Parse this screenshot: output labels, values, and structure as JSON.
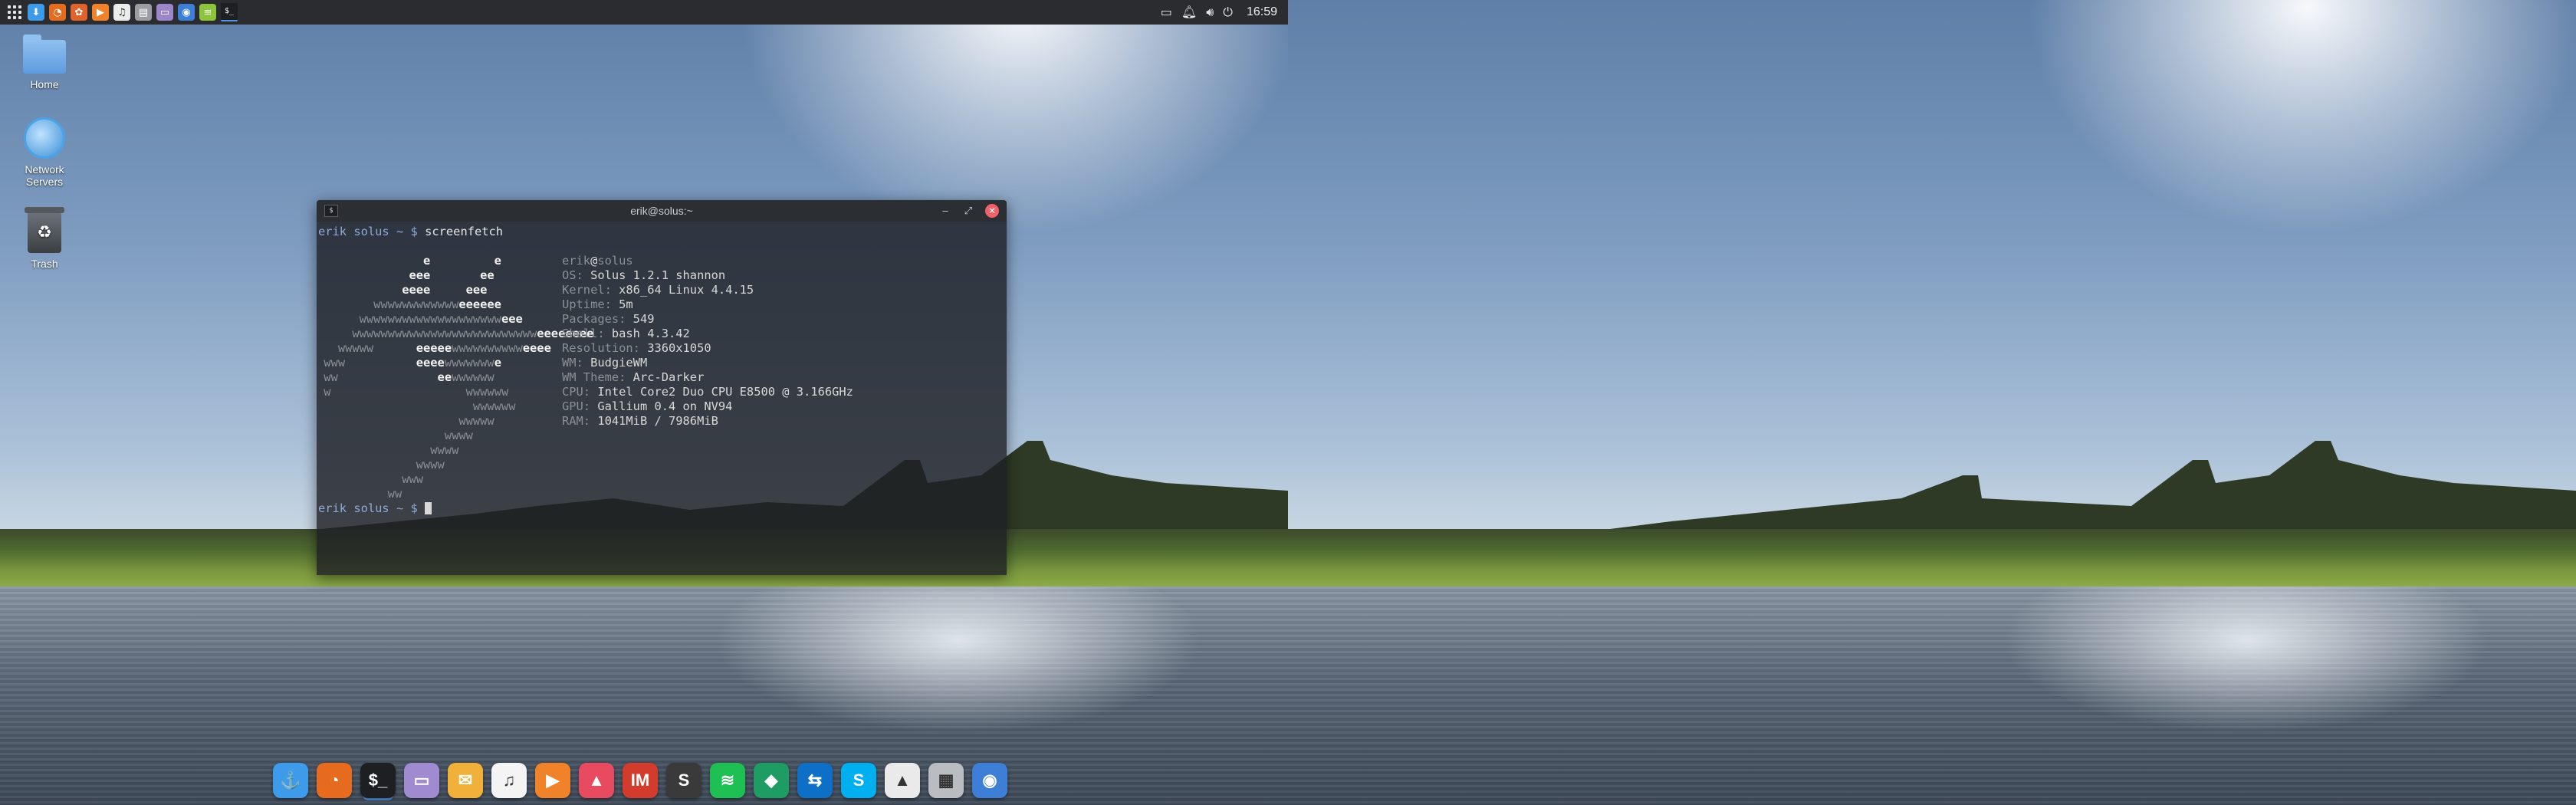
{
  "top_panel": {
    "apps": [
      {
        "icon": "app-menu-icon",
        "color": "#2a2c30"
      },
      {
        "icon": "software-center-icon",
        "color": "#3d9be9"
      },
      {
        "icon": "firefox-icon",
        "color": "#e66b1f"
      },
      {
        "icon": "budgie-settings-icon",
        "color": "#e0632b"
      },
      {
        "icon": "media-player-icon",
        "color": "#f0822a"
      },
      {
        "icon": "music-player-icon",
        "color": "#ececec"
      },
      {
        "icon": "system-monitor-icon",
        "color": "#9a9da2"
      },
      {
        "icon": "file-manager-icon",
        "color": "#9b86c9"
      },
      {
        "icon": "screenshot-icon",
        "color": "#3d7fd6"
      },
      {
        "icon": "text-editor-icon",
        "color": "#8cc43c"
      },
      {
        "icon": "terminal-icon",
        "color": "#1d1f22"
      }
    ],
    "tray": [
      "display-icon",
      "notification-icon",
      "volume-icon",
      "power-icon"
    ],
    "clock": "16:59"
  },
  "desktop": {
    "icons": [
      {
        "label": "Home",
        "icon": "home-folder-icon"
      },
      {
        "label": "Network",
        "label2": "Servers",
        "icon": "network-servers-icon"
      },
      {
        "label": "Trash",
        "icon": "trash-icon"
      }
    ]
  },
  "terminal": {
    "title": "erik@solus:~",
    "prompt_user": "erik",
    "prompt_host": "solus",
    "prompt_path": "~",
    "prompt_symbol": "$",
    "command": "screenfetch",
    "logo_lines": [
      [
        "",
        "               ",
        "e",
        "         ",
        "e",
        ""
      ],
      [
        "",
        "             ",
        "eee",
        "       ",
        "ee",
        ""
      ],
      [
        "",
        "            ",
        "eeee",
        "     ",
        "eee",
        ""
      ],
      [
        "",
        "        ",
        "",
        "",
        "",
        "wwwwwwwwwwwweeeeee"
      ],
      [
        "",
        "      ",
        "",
        "",
        "",
        "wwwwwwwwwwwwwwwwwwwweee"
      ],
      [
        "",
        "     ",
        "",
        "",
        "",
        "wwwwwwwwwwwwwwwwwwwwwwwwwweeeeeeee"
      ],
      [
        "",
        "   ",
        "",
        "",
        "",
        "wwwww      eeeeewwwwwwwwwweeee"
      ],
      [
        "",
        " ",
        "",
        "",
        "",
        "www          eeeewwwwwwwe"
      ],
      [
        "",
        " ",
        "",
        "",
        "",
        "ww              eewwwwww"
      ],
      [
        "",
        " ",
        "",
        "",
        "",
        "w                   wwwwww"
      ],
      [
        "",
        "                      ",
        "",
        "",
        "",
        "wwwwww"
      ],
      [
        "",
        "                    ",
        "",
        "",
        "",
        "wwwww"
      ],
      [
        "",
        "                  ",
        "",
        "",
        "",
        "wwww"
      ],
      [
        "",
        "                ",
        "",
        "",
        "",
        "wwww"
      ],
      [
        "",
        "              ",
        "",
        "",
        "",
        "wwww"
      ],
      [
        "",
        "            ",
        "",
        "",
        "",
        "www"
      ],
      [
        "",
        "          ",
        "",
        "",
        "",
        "ww"
      ]
    ],
    "info": [
      {
        "key": "erik",
        "sep": "@",
        "val": "solus"
      },
      {
        "key": "OS:",
        "val": " Solus 1.2.1 shannon"
      },
      {
        "key": "Kernel:",
        "val": " x86_64 Linux 4.4.15"
      },
      {
        "key": "Uptime:",
        "val": " 5m"
      },
      {
        "key": "Packages:",
        "val": " 549"
      },
      {
        "key": "Shell:",
        "val": " bash 4.3.42"
      },
      {
        "key": "Resolution:",
        "val": " 3360x1050"
      },
      {
        "key": "WM:",
        "val": " BudgieWM"
      },
      {
        "key": "WM Theme:",
        "val": " Arc-Darker"
      },
      {
        "key": "CPU:",
        "val": " Intel Core2 Duo CPU E8500 @ 3.166GHz"
      },
      {
        "key": "GPU:",
        "val": " Gallium 0.4 on NV94"
      },
      {
        "key": "RAM:",
        "val": " 1041MiB / 7986MiB"
      }
    ]
  },
  "dock": {
    "items": [
      {
        "icon": "anchor-icon",
        "glyph": "⚓",
        "color": "#3d9be9"
      },
      {
        "icon": "firefox-icon",
        "glyph": "◔",
        "color": "#e66b1f"
      },
      {
        "icon": "terminal-icon",
        "glyph": "$_",
        "color": "#1d1f22",
        "active": true
      },
      {
        "icon": "file-manager-icon",
        "glyph": "▭",
        "color": "#a08ad0"
      },
      {
        "icon": "mail-icon",
        "glyph": "✉",
        "color": "#f0b03a"
      },
      {
        "icon": "music-icon",
        "glyph": "♫",
        "color": "#f4f4f4"
      },
      {
        "icon": "video-player-icon",
        "glyph": "▶",
        "color": "#f0822a"
      },
      {
        "icon": "image-viewer-icon",
        "glyph": "▲",
        "color": "#e84a5f"
      },
      {
        "icon": "im-client-icon",
        "glyph": "IM",
        "color": "#d33b2c"
      },
      {
        "icon": "sublime-text-icon",
        "glyph": "S",
        "color": "#3a3a3a"
      },
      {
        "icon": "spotify-icon",
        "glyph": "≋",
        "color": "#1ec054"
      },
      {
        "icon": "vpn-icon",
        "glyph": "◆",
        "color": "#1e9c63"
      },
      {
        "icon": "teamviewer-icon",
        "glyph": "⇆",
        "color": "#0e6fc7"
      },
      {
        "icon": "skype-icon",
        "glyph": "S",
        "color": "#00aff0"
      },
      {
        "icon": "inkscape-icon",
        "glyph": "▲",
        "color": "#eaeaea"
      },
      {
        "icon": "virtual-machine-icon",
        "glyph": "▦",
        "color": "#b9bcc0"
      },
      {
        "icon": "screenshot-icon",
        "glyph": "◉",
        "color": "#3d7fd6"
      }
    ]
  }
}
